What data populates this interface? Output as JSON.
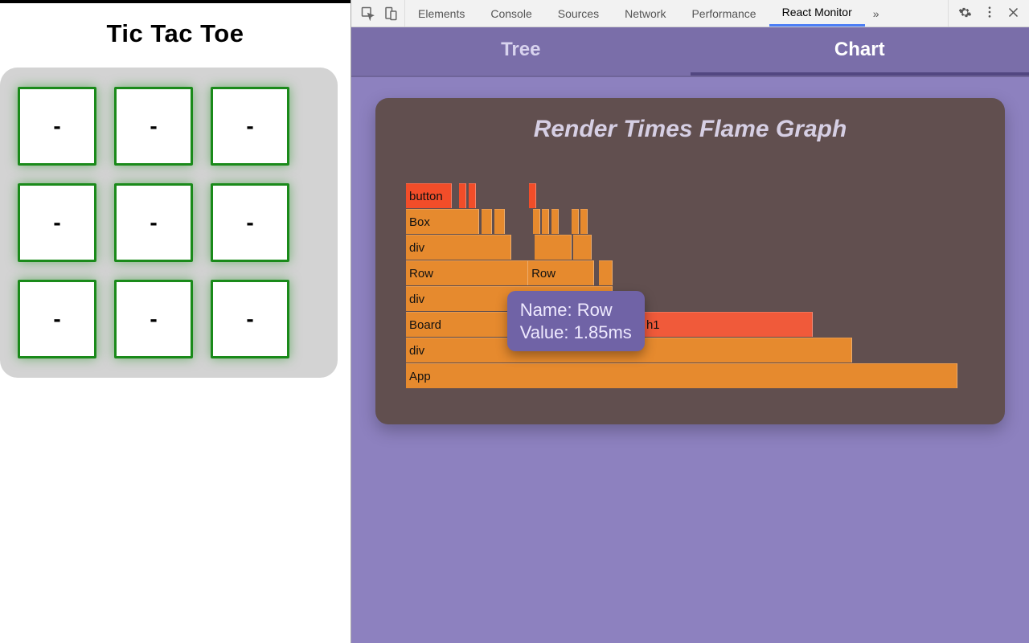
{
  "app": {
    "title": "Tic Tac Toe",
    "cells": [
      "-",
      "-",
      "-",
      "-",
      "-",
      "-",
      "-",
      "-",
      "-"
    ]
  },
  "devtools": {
    "tabs": [
      "Elements",
      "Console",
      "Sources",
      "Network",
      "Performance",
      "React Monitor"
    ],
    "active_tab_index": 5,
    "overflow_glyph": "»"
  },
  "extension": {
    "tabs": {
      "tree": "Tree",
      "chart": "Chart"
    },
    "active_tab": "chart",
    "chart_title": "Render Times Flame Graph",
    "tooltip": {
      "name_label": "Name:",
      "value_label": "Value:",
      "name": "Row",
      "value": "1.85ms"
    }
  },
  "chart_data": {
    "type": "flame",
    "title": "Render Times Flame Graph",
    "unit": "ms",
    "total_width_ms": 6.0,
    "levels": [
      [
        {
          "name": "App",
          "start": 0.0,
          "end": 6.0,
          "color": "orange"
        }
      ],
      [
        {
          "name": "div",
          "start": 0.0,
          "end": 4.85,
          "color": "orange"
        }
      ],
      [
        {
          "name": "Board",
          "start": 0.0,
          "end": 2.58,
          "color": "orange"
        },
        {
          "name": "h1",
          "start": 2.58,
          "end": 4.43,
          "color": "hot-soft"
        }
      ],
      [
        {
          "name": "div",
          "start": 0.0,
          "end": 2.25,
          "color": "orange"
        }
      ],
      [
        {
          "name": "Row",
          "start": 0.0,
          "end": 1.33,
          "color": "orange"
        },
        {
          "name": "Row",
          "start": 1.33,
          "end": 2.05,
          "color": "orange"
        },
        {
          "name": "",
          "start": 2.1,
          "end": 2.25,
          "color": "orange"
        }
      ],
      [
        {
          "name": "div",
          "start": 0.0,
          "end": 1.15,
          "color": "orange"
        },
        {
          "name": "",
          "start": 1.4,
          "end": 1.8,
          "color": "orange"
        },
        {
          "name": "",
          "start": 1.82,
          "end": 2.02,
          "color": "orange"
        }
      ],
      [
        {
          "name": "Box",
          "start": 0.0,
          "end": 0.8,
          "color": "orange"
        },
        {
          "name": "",
          "start": 0.82,
          "end": 0.94,
          "color": "orange"
        },
        {
          "name": "",
          "start": 0.96,
          "end": 1.08,
          "color": "orange"
        },
        {
          "name": "",
          "start": 1.38,
          "end": 1.46,
          "color": "orange"
        },
        {
          "name": "",
          "start": 1.48,
          "end": 1.56,
          "color": "orange"
        },
        {
          "name": "",
          "start": 1.58,
          "end": 1.66,
          "color": "orange"
        },
        {
          "name": "",
          "start": 1.8,
          "end": 1.88,
          "color": "orange"
        },
        {
          "name": "",
          "start": 1.9,
          "end": 1.98,
          "color": "orange"
        }
      ],
      [
        {
          "name": "button",
          "start": 0.0,
          "end": 0.5,
          "color": "hot"
        },
        {
          "name": "",
          "start": 0.58,
          "end": 0.66,
          "color": "hot"
        },
        {
          "name": "",
          "start": 0.68,
          "end": 0.76,
          "color": "hot"
        },
        {
          "name": "",
          "start": 1.34,
          "end": 1.42,
          "color": "hot"
        }
      ]
    ]
  }
}
